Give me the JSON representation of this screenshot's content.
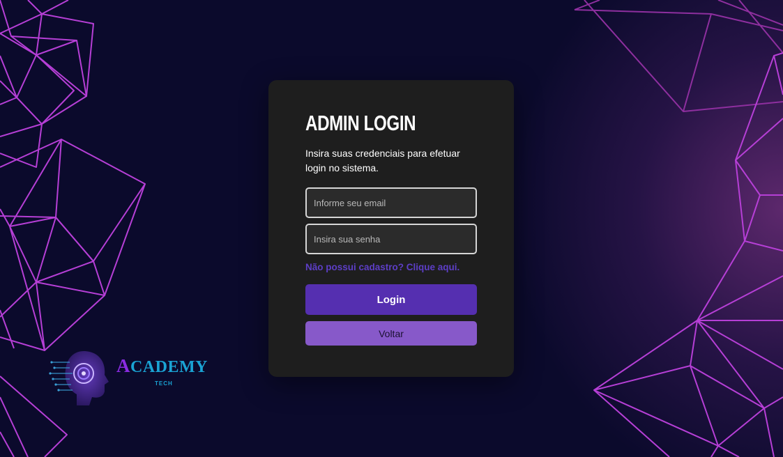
{
  "login": {
    "title": "ADMIN LOGIN",
    "subtitle": "Insira suas credenciais para efetuar login no sistema.",
    "email_placeholder": "Informe seu email",
    "email_value": "",
    "password_placeholder": "Insira sua senha",
    "password_value": "",
    "register_link": "Não possui cadastro? Clique aqui.",
    "login_button": "Login",
    "back_button": "Voltar"
  },
  "brand": {
    "name_first_letter": "A",
    "name_rest": "CADEMY",
    "tagline": "TECH",
    "icon": "robot-head-icon"
  },
  "colors": {
    "background": "#0b0a2c",
    "card": "#1e1e1e",
    "accent": "#552fb0",
    "secondary_button": "#8759c9",
    "link": "#5d3ec6",
    "polygon_lines": "#b63fd6"
  }
}
